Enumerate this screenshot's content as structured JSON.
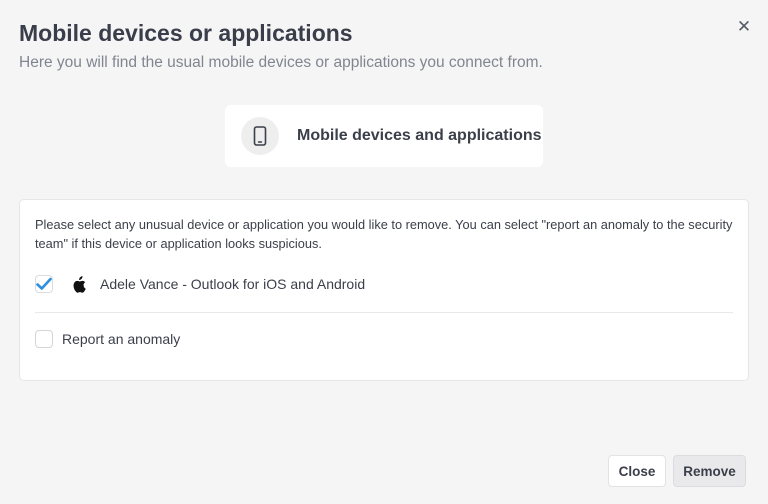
{
  "dialog": {
    "title": "Mobile devices or applications",
    "subtitle": "Here you will find the usual mobile devices or applications you connect from.",
    "close_icon": "close-icon"
  },
  "device_card": {
    "icon": "smartphone-icon",
    "label": "Mobile devices and applications"
  },
  "panel": {
    "instructions": "Please select any unusual device or application you would like to remove. You can select \"report an anomaly to the security team\" if this device or application looks suspicious.",
    "devices": [
      {
        "checked": true,
        "icon": "apple-icon",
        "label": "Adele Vance - Outlook for iOS and Android"
      }
    ],
    "report_anomaly": {
      "checked": false,
      "label": "Report an anomaly"
    }
  },
  "footer": {
    "close_label": "Close",
    "remove_label": "Remove"
  },
  "colors": {
    "check_accent": "#2f8fdf",
    "background": "#f5f5f5",
    "text": "#3b3f4a",
    "subtle_text": "#808590"
  }
}
